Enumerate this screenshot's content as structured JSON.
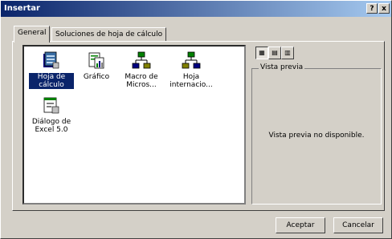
{
  "window": {
    "title": "Insertar",
    "help_glyph": "?",
    "close_glyph": "x"
  },
  "tabs": [
    {
      "label": "General",
      "active": true
    },
    {
      "label": "Soluciones de hoja de cálculo",
      "active": false
    }
  ],
  "items": [
    {
      "label": "Hoja de cálculo",
      "icon": "worksheet-icon",
      "selected": true
    },
    {
      "label": "Gráfico",
      "icon": "chart-sheet-icon",
      "selected": false
    },
    {
      "label": "Macro de Micros...",
      "icon": "macro-sheet-icon",
      "selected": false
    },
    {
      "label": "Hoja internacio...",
      "icon": "international-macro-sheet-icon",
      "selected": false
    },
    {
      "label": "Diálogo de Excel 5.0",
      "icon": "dialog-sheet-icon",
      "selected": false
    }
  ],
  "view_buttons": [
    {
      "icon": "large-icons-view-icon",
      "active": true
    },
    {
      "icon": "list-view-icon",
      "active": false
    },
    {
      "icon": "details-view-icon",
      "active": false
    }
  ],
  "preview": {
    "legend": "Vista previa",
    "message": "Vista previa no disponible."
  },
  "buttons": {
    "ok": "Aceptar",
    "cancel": "Cancelar"
  },
  "colors": {
    "titlebar_start": "#0a246a",
    "titlebar_end": "#a6caf0",
    "face": "#d4d0c8",
    "selection": "#0a246a"
  }
}
